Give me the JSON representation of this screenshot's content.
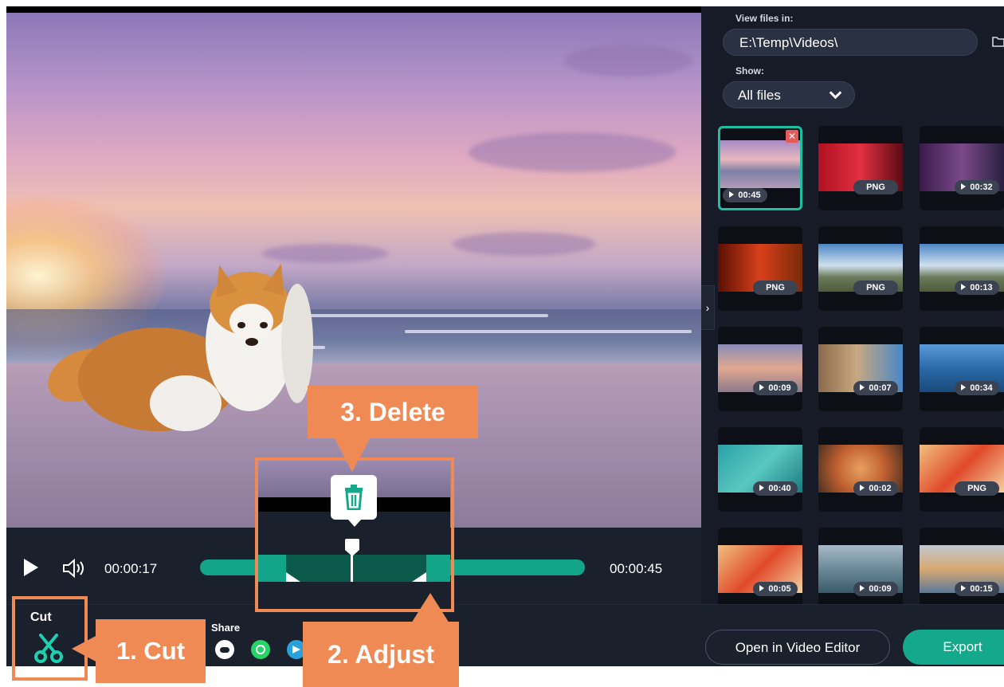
{
  "player": {
    "current_time": "00:00:17",
    "total_time": "00:00:45",
    "progress": 0.378
  },
  "sidebar": {
    "view_files_label": "View files in:",
    "path_value": "E:\\Temp\\Videos\\",
    "show_label": "Show:",
    "filter_value": "All files",
    "thumbnails": [
      {
        "badge": "00:45",
        "kind": "video",
        "selected": true
      },
      {
        "badge": "PNG",
        "kind": "image"
      },
      {
        "badge": "00:32",
        "kind": "video"
      },
      {
        "badge": "PNG",
        "kind": "image"
      },
      {
        "badge": "PNG",
        "kind": "image"
      },
      {
        "badge": "00:13",
        "kind": "video"
      },
      {
        "badge": "00:09",
        "kind": "video"
      },
      {
        "badge": "00:07",
        "kind": "video"
      },
      {
        "badge": "00:34",
        "kind": "video"
      },
      {
        "badge": "00:40",
        "kind": "video"
      },
      {
        "badge": "00:02",
        "kind": "video"
      },
      {
        "badge": "PNG",
        "kind": "image"
      },
      {
        "badge": "00:05",
        "kind": "video"
      },
      {
        "badge": "00:09",
        "kind": "video"
      },
      {
        "badge": "00:15",
        "kind": "video"
      }
    ]
  },
  "toolbar": {
    "cut_label": "Cut",
    "share_label": "Share",
    "open_editor_label": "Open in Video Editor",
    "export_label": "Export"
  },
  "callouts": {
    "cut": "1. Cut",
    "adjust": "2. Adjust",
    "delete": "3. Delete"
  },
  "colors": {
    "accent": "#14a98c",
    "callout": "#f08a55",
    "background": "#1b202d"
  },
  "icons": [
    "play-icon",
    "volume-icon",
    "scissors-icon",
    "trash-icon",
    "folder-icon",
    "chevron-down-icon",
    "chevron-right-icon",
    "cloud-icon",
    "whatsapp-icon",
    "telegram-icon"
  ]
}
